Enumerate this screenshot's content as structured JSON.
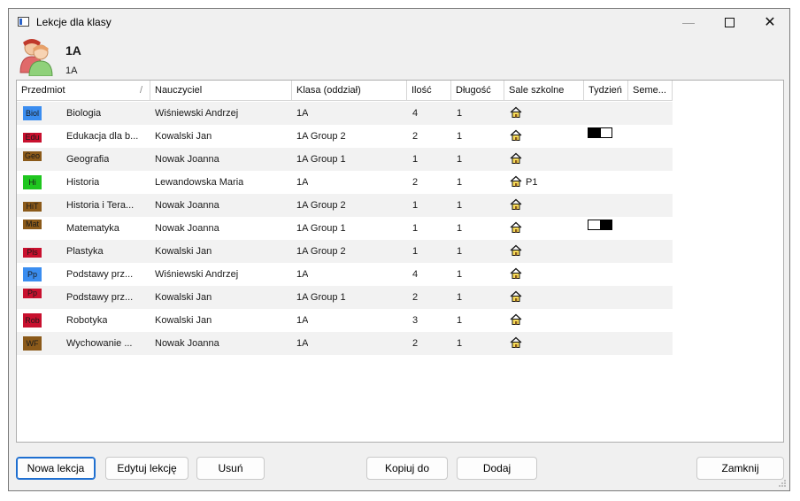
{
  "window": {
    "title": "Lekcje dla klasy"
  },
  "header": {
    "class_name": "1A",
    "class_sub": "1A"
  },
  "table": {
    "columns": [
      "Przedmiot",
      "Nauczyciel",
      "Klasa (oddział)",
      "Ilość",
      "Długość",
      "Sale szkolne",
      "Tydzień",
      "Seme..."
    ],
    "rows": [
      {
        "abbr": "Biol",
        "color": "#3a8df0",
        "subject": "Biologia",
        "teacher": "Wiśniewski Andrzej",
        "class": "1A",
        "count": "4",
        "length": "1",
        "room": "",
        "week": ""
      },
      {
        "abbr": "Edu",
        "color": "#c8102e",
        "subject": "Edukacja dla b...",
        "teacher": "Kowalski Jan",
        "class": "1A Group 2",
        "count": "2",
        "length": "1",
        "room": "",
        "week": "A"
      },
      {
        "abbr": "Geo",
        "color": "#8b5a1a",
        "subject": "Geografia",
        "teacher": "Nowak Joanna",
        "class": "1A Group 1",
        "count": "1",
        "length": "1",
        "room": "",
        "week": ""
      },
      {
        "abbr": "Hi",
        "color": "#1fc61f",
        "subject": "Historia",
        "teacher": "Lewandowska Maria",
        "class": "1A",
        "count": "2",
        "length": "1",
        "room": "P1",
        "week": ""
      },
      {
        "abbr": "HiT",
        "color": "#8b5a1a",
        "subject": "Historia i Tera...",
        "teacher": "Nowak Joanna",
        "class": "1A Group 2",
        "count": "1",
        "length": "1",
        "room": "",
        "week": ""
      },
      {
        "abbr": "Mat",
        "color": "#8b5a1a",
        "subject": "Matematyka",
        "teacher": "Nowak Joanna",
        "class": "1A Group 1",
        "count": "1",
        "length": "1",
        "room": "",
        "week": "B"
      },
      {
        "abbr": "Pls",
        "color": "#c8102e",
        "subject": "Plastyka",
        "teacher": "Kowalski Jan",
        "class": "1A Group 2",
        "count": "1",
        "length": "1",
        "room": "",
        "week": ""
      },
      {
        "abbr": "Pp",
        "color": "#3a8df0",
        "subject": "Podstawy prz...",
        "teacher": "Wiśniewski Andrzej",
        "class": "1A",
        "count": "4",
        "length": "1",
        "room": "",
        "week": ""
      },
      {
        "abbr": "Pp",
        "color": "#c8102e",
        "subject": "Podstawy prz...",
        "teacher": "Kowalski Jan",
        "class": "1A Group 1",
        "count": "2",
        "length": "1",
        "room": "",
        "week": ""
      },
      {
        "abbr": "Rob",
        "color": "#c8102e",
        "subject": "Robotyka",
        "teacher": "Kowalski Jan",
        "class": "1A",
        "count": "3",
        "length": "1",
        "room": "",
        "week": ""
      },
      {
        "abbr": "WF",
        "color": "#8b5a1a",
        "subject": "Wychowanie ...",
        "teacher": "Nowak Joanna",
        "class": "1A",
        "count": "2",
        "length": "1",
        "room": "",
        "week": ""
      }
    ]
  },
  "buttons": {
    "new_lesson": "Nowa lekcja",
    "edit_lesson": "Edytuj lekcję",
    "delete": "Usuń",
    "copy_to": "Kopiuj do",
    "add": "Dodaj",
    "close": "Zamknij"
  },
  "colors": {
    "accent": "#1f6fd0",
    "alt_row": "#f2f2f2"
  },
  "icons": [
    "app-icon",
    "minimize-icon",
    "maximize-icon",
    "close-icon",
    "user-group-icon",
    "room-house-icon",
    "resize-grip-icon"
  ]
}
